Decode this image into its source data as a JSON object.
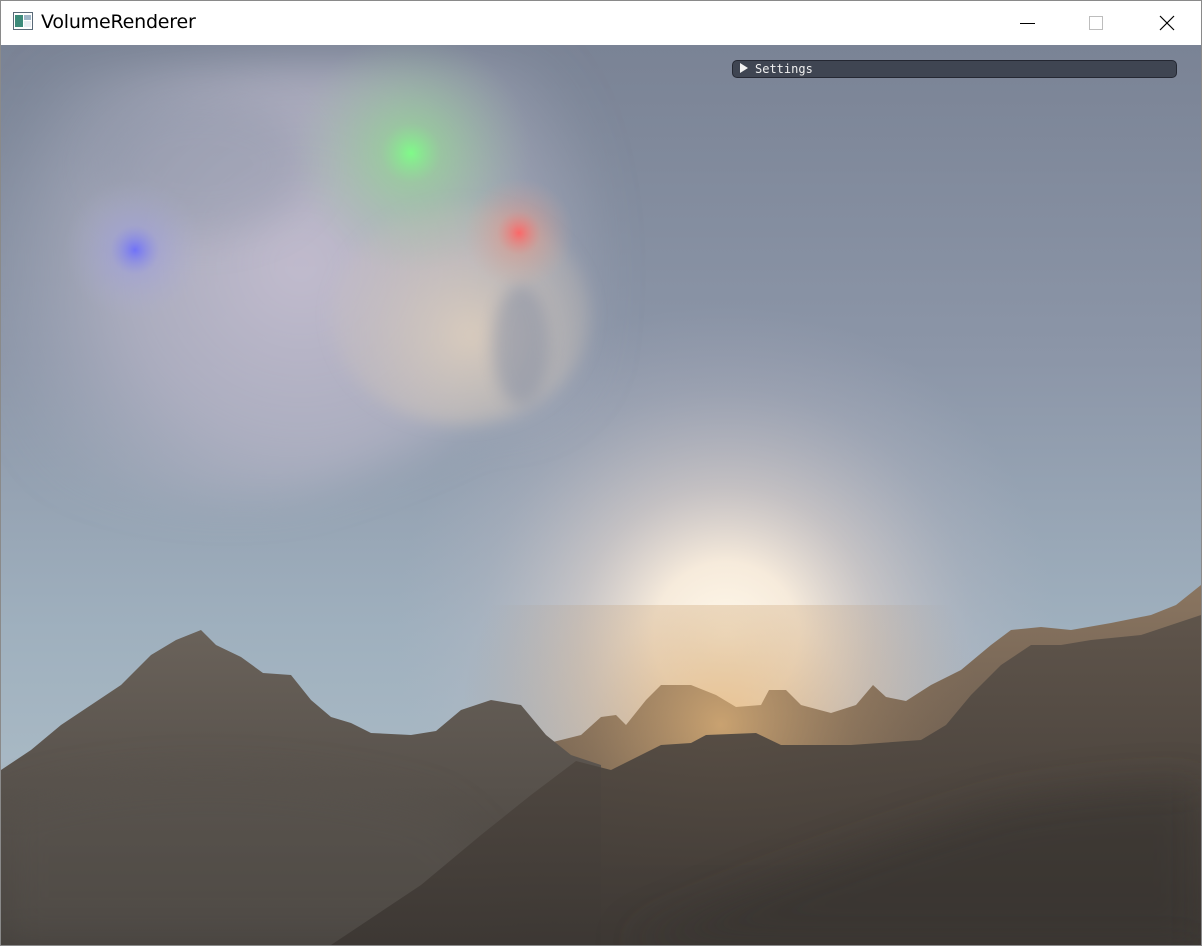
{
  "window": {
    "title": "VolumeRenderer",
    "icon": "app-window-icon",
    "controls": {
      "minimize": "minimize-icon",
      "maximize": "maximize-icon",
      "close": "close-icon"
    }
  },
  "overlay": {
    "settings_label": "Settings",
    "settings_expanded": false,
    "arrow_icon": "collapsed-triangle-icon"
  },
  "scene": {
    "sky_top": "#7f8a9c",
    "sky_bottom": "#a6b6c4",
    "sun_color": "#fff6e4",
    "cloud_light_colors": [
      "#6cff7a",
      "#ff5b5b",
      "#6a6bff"
    ],
    "mountain_near": "#3f3a35",
    "mountain_far": "#6c6156"
  }
}
